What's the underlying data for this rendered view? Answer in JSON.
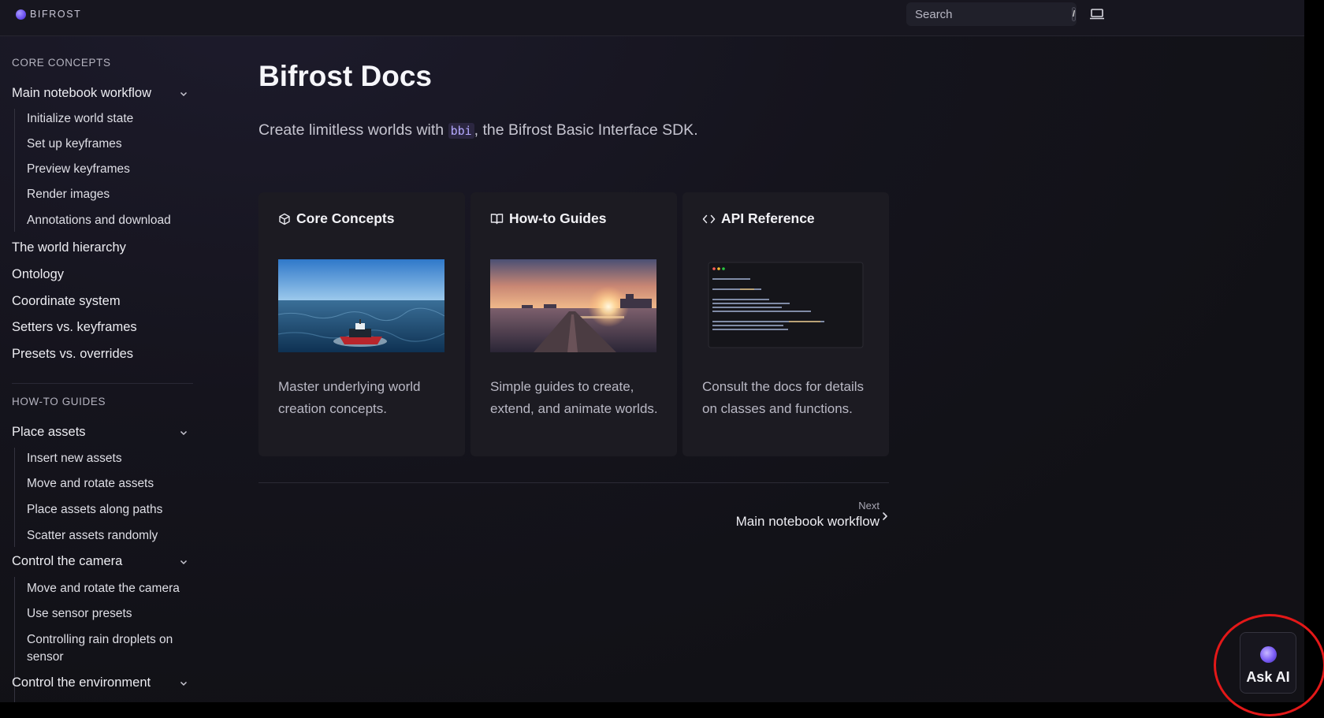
{
  "app": {
    "logo_text": "BIFROST"
  },
  "search": {
    "placeholder": "Search",
    "shortcut": "/"
  },
  "sidebar": {
    "sections": [
      {
        "title": "CORE CONCEPTS"
      },
      {
        "title": "HOW-TO GUIDES"
      }
    ],
    "core": {
      "main_workflow": "Main notebook workflow",
      "main_workflow_children": [
        "Initialize world state",
        "Set up keyframes",
        "Preview keyframes",
        "Render images",
        "Annotations and download"
      ],
      "items": [
        "The world hierarchy",
        "Ontology",
        "Coordinate system",
        "Setters vs. keyframes",
        "Presets vs. overrides"
      ]
    },
    "howto": {
      "place_assets": "Place assets",
      "place_assets_children": [
        "Insert new assets",
        "Move and rotate assets",
        "Place assets along paths",
        "Scatter assets randomly"
      ],
      "control_camera": "Control the camera",
      "control_camera_children": [
        "Move and rotate the camera",
        "Use sensor presets",
        "Controlling rain droplets on sensor"
      ],
      "control_environment": "Control the environment"
    }
  },
  "main": {
    "title": "Bifrost Docs",
    "subtitle_before": "Create limitless worlds with ",
    "subtitle_code": "bbi",
    "subtitle_after": ", the Bifrost Basic Interface SDK.",
    "cards": [
      {
        "title": "Core Concepts",
        "icon": "cube-icon",
        "description": "Master underlying world creation concepts."
      },
      {
        "title": "How-to Guides",
        "icon": "book-icon",
        "description": "Simple guides to create, extend, and animate worlds."
      },
      {
        "title": "API Reference",
        "icon": "code-icon",
        "description": "Consult the docs for details on classes and functions."
      }
    ],
    "next": {
      "label": "Next",
      "title": "Main notebook workflow"
    }
  },
  "ask_ai": {
    "label": "Ask AI"
  },
  "colors": {
    "accent": "#7a5cf5",
    "highlight_ring": "#e31818",
    "background": "#15141d"
  }
}
